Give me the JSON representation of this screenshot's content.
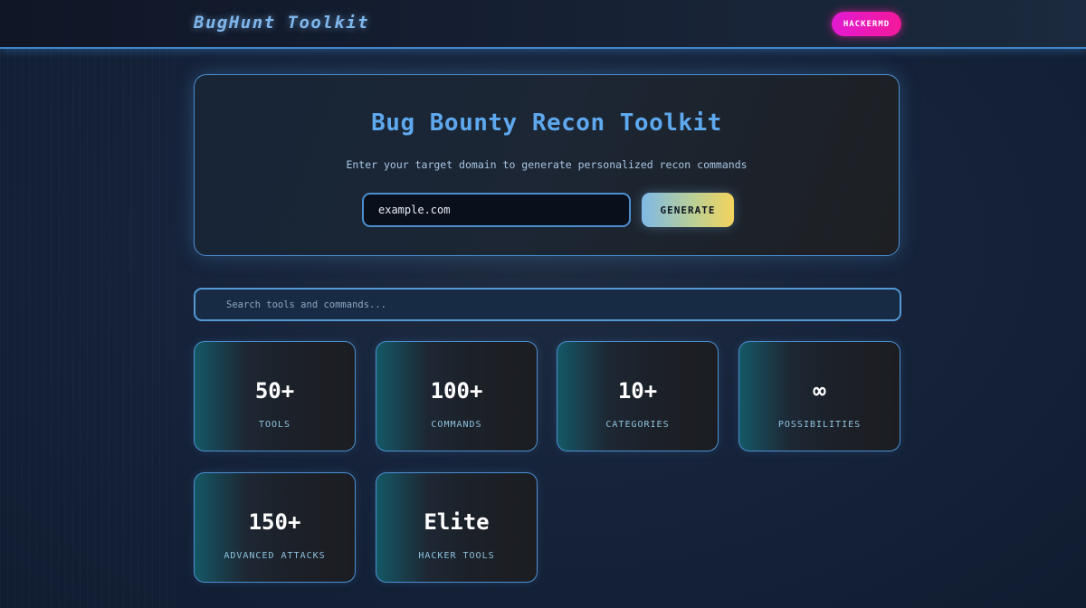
{
  "header": {
    "brand": "BugHunt Toolkit",
    "user_button": "HACKERMD"
  },
  "hero": {
    "title": "Bug Bounty Recon Toolkit",
    "subtitle": "Enter your target domain to generate personalized recon commands",
    "domain_value": "example.com",
    "generate_label": "GENERATE"
  },
  "search": {
    "placeholder": "Search tools and commands..."
  },
  "stats": [
    {
      "value": "50+",
      "label": "TOOLS"
    },
    {
      "value": "100+",
      "label": "COMMANDS"
    },
    {
      "value": "10+",
      "label": "CATEGORIES"
    },
    {
      "value": "∞",
      "label": "POSSIBILITIES"
    },
    {
      "value": "150+",
      "label": "ADVANCED ATTACKS"
    },
    {
      "value": "Elite",
      "label": "HACKER TOOLS"
    }
  ],
  "colors": {
    "accent_blue": "#5ea8ee",
    "border_blue": "#4b8fd0",
    "user_button_pink": "#f3199b",
    "generate_gradient_start": "#7fb9e6",
    "generate_gradient_end": "#f4d35c"
  }
}
